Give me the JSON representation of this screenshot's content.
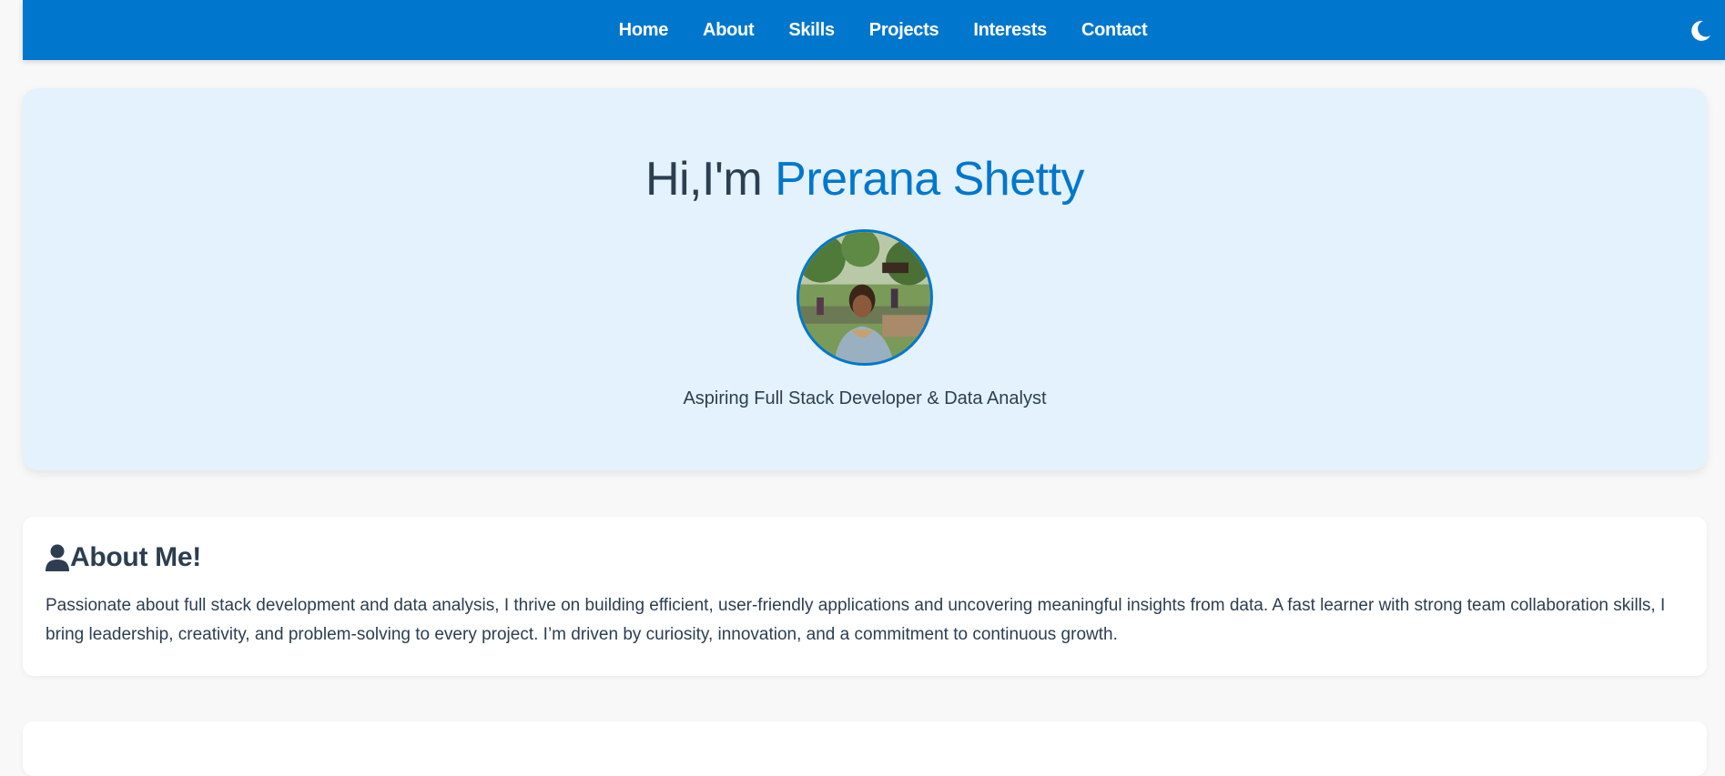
{
  "nav": {
    "links": [
      {
        "label": "Home"
      },
      {
        "label": "About"
      },
      {
        "label": "Skills"
      },
      {
        "label": "Projects"
      },
      {
        "label": "Interests"
      },
      {
        "label": "Contact"
      }
    ],
    "theme_toggle_icon": "moon-icon"
  },
  "hero": {
    "greeting": "Hi,I'm ",
    "name": "Prerana Shetty",
    "subtitle": "Aspiring Full Stack Developer & Data Analyst"
  },
  "about": {
    "icon": "user-icon",
    "heading": "About Me!",
    "text": "Passionate about full stack development and data analysis, I thrive on building efficient, user-friendly applications and uncovering meaningful insights from data. A fast learner with strong team collaboration skills, I bring leadership, creativity, and problem-solving to every project. I’m driven by curiosity, innovation, and a commitment to continuous growth."
  },
  "colors": {
    "primary": "#0077cc",
    "hero_bg": "#e3f2fd",
    "page_bg": "#f8f8f8",
    "text": "#2c3e50"
  }
}
